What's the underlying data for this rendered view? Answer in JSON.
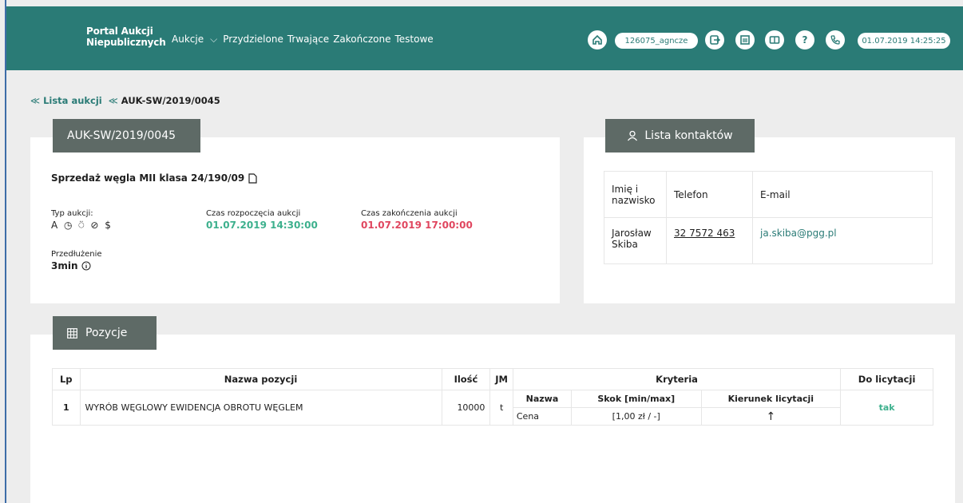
{
  "header": {
    "brand_line1": "Portal Aukcji",
    "brand_line2": "Niepublicznych",
    "nav": {
      "aukcje": "Aukcje",
      "chevron": "⌵",
      "przydzielone": "Przydzielone",
      "trwajace": "Trwające",
      "zakonczone": "Zakończone",
      "testowe": "Testowe"
    },
    "user": "126075_agncze",
    "datetime": "01.07.2019 14:25:25",
    "icons": [
      "home-icon",
      "logout-icon",
      "building-icon",
      "book-icon",
      "help-icon",
      "phone-icon"
    ]
  },
  "breadcrumb": {
    "list": "Lista aukcji",
    "current": "AUK-SW/2019/0045",
    "sep": "≪"
  },
  "auction": {
    "tab": "AUK-SW/2019/0045",
    "title": "Sprzedaż węgla MII klasa 24/190/09",
    "type_label": "Typ aukcji:",
    "type_icons": "A ◷ ⍥ ⊘ $",
    "start_label": "Czas rozpoczęcia aukcji",
    "start_value": "01.07.2019 14:30:00",
    "end_label": "Czas zakończenia aukcji",
    "end_value": "01.07.2019 17:00:00",
    "extension_label": "Przedłużenie",
    "extension_value": "3min"
  },
  "contacts": {
    "tab": "Lista kontaktów",
    "headers": [
      "Imię i nazwisko",
      "Telefon",
      "E-mail"
    ],
    "rows": [
      {
        "name": "Jarosław Skiba",
        "phone": "32 7572 463",
        "email": "ja.skiba@pgg.pl"
      }
    ]
  },
  "positions": {
    "tab": "Pozycje",
    "headers": {
      "lp": "Lp",
      "name": "Nazwa pozycji",
      "qty": "Ilość",
      "unit": "JM",
      "criteria": "Kryteria",
      "bidding": "Do licytacji"
    },
    "criteria_headers": {
      "name": "Nazwa",
      "step": "Skok [min/max]",
      "direction": "Kierunek licytacji"
    },
    "rows": [
      {
        "lp": "1",
        "name": "WYRÓB WĘGLOWY EWIDENCJA OBROTU WĘGLEM",
        "qty": "10000",
        "unit": "t",
        "criterion_name": "Cena",
        "criterion_step": "[1,00 zł / -]",
        "criterion_direction": "↑",
        "bidding": "tak"
      }
    ]
  },
  "colors": {
    "header_bg": "#2a7b76",
    "tab_bg": "#5e6a66",
    "green": "#3db08d",
    "red": "#e0465f"
  }
}
